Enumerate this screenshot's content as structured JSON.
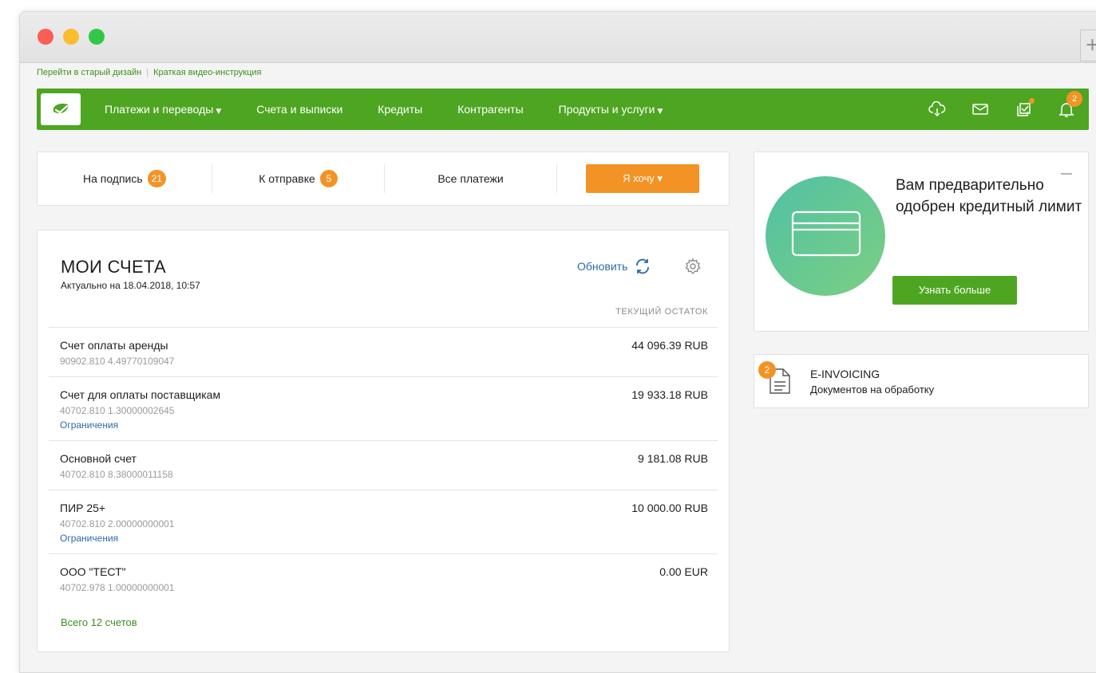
{
  "window": {
    "new_tab_label": "+"
  },
  "top_links": {
    "old_design": "Перейти в старый дизайн",
    "separator": "|",
    "video_guide": "Краткая видео-инструкция"
  },
  "nav": {
    "items": [
      {
        "label": "Платежи и переводы",
        "has_dropdown": true,
        "caret": "▼"
      },
      {
        "label": "Счета и выписки",
        "has_dropdown": false,
        "caret": ""
      },
      {
        "label": "Кредиты",
        "has_dropdown": false,
        "caret": ""
      },
      {
        "label": "Контрагенты",
        "has_dropdown": false,
        "caret": ""
      },
      {
        "label": "Продукты и услуги",
        "has_dropdown": true,
        "caret": "▼"
      }
    ],
    "icons": {
      "cloud": "cloud-download-icon",
      "mail": "mail-icon",
      "tasks": "tasks-check-icon",
      "bell": "bell-icon"
    },
    "bell_count": "2"
  },
  "tabs": {
    "to_sign_label": "На подпись",
    "to_sign_count": "21",
    "to_send_label": "К отправке",
    "to_send_count": "5",
    "all_payments_label": "Все платежи",
    "want_button_label": "Я хочу ▾"
  },
  "accounts": {
    "title": "МОИ СЧЕТА",
    "updated": "Актуально на 18.04.2018, 10:57",
    "refresh_label": "Обновить",
    "balance_header": "ТЕКУЩИЙ ОСТАТОК",
    "rows": [
      {
        "name": "Счет оплаты аренды",
        "number": "90902.810 4.49770109047",
        "balance": "44 096.39 RUB",
        "limit": ""
      },
      {
        "name": "Счет для оплаты поставщикам",
        "number": "40702.810 1.30000002645",
        "balance": "19 933.18 RUB",
        "limit": "Ограничения"
      },
      {
        "name": "Основной счет",
        "number": "40702.810 8.38000011158",
        "balance": "9 181.08 RUB",
        "limit": ""
      },
      {
        "name": "ПИР 25+",
        "number": "40702.810 2.00000000001",
        "balance": "10 000.00 RUB",
        "limit": "Ограничения"
      },
      {
        "name": "ООО \"ТЕСТ\"",
        "number": "40702.978 1.00000000001",
        "balance": "0.00 EUR",
        "limit": ""
      }
    ],
    "total_link": "Всего 12 счетов"
  },
  "promo": {
    "title": "Вам предварительно одобрен кредитный лимит",
    "button_label": "Узнать больше"
  },
  "einvoicing": {
    "badge": "2",
    "title": "E-INVOICING",
    "subtitle": "Документов на обработку"
  },
  "colors": {
    "brand_green": "#4ea521",
    "accent_orange": "#f39325",
    "link_blue": "#2e6aa9"
  }
}
